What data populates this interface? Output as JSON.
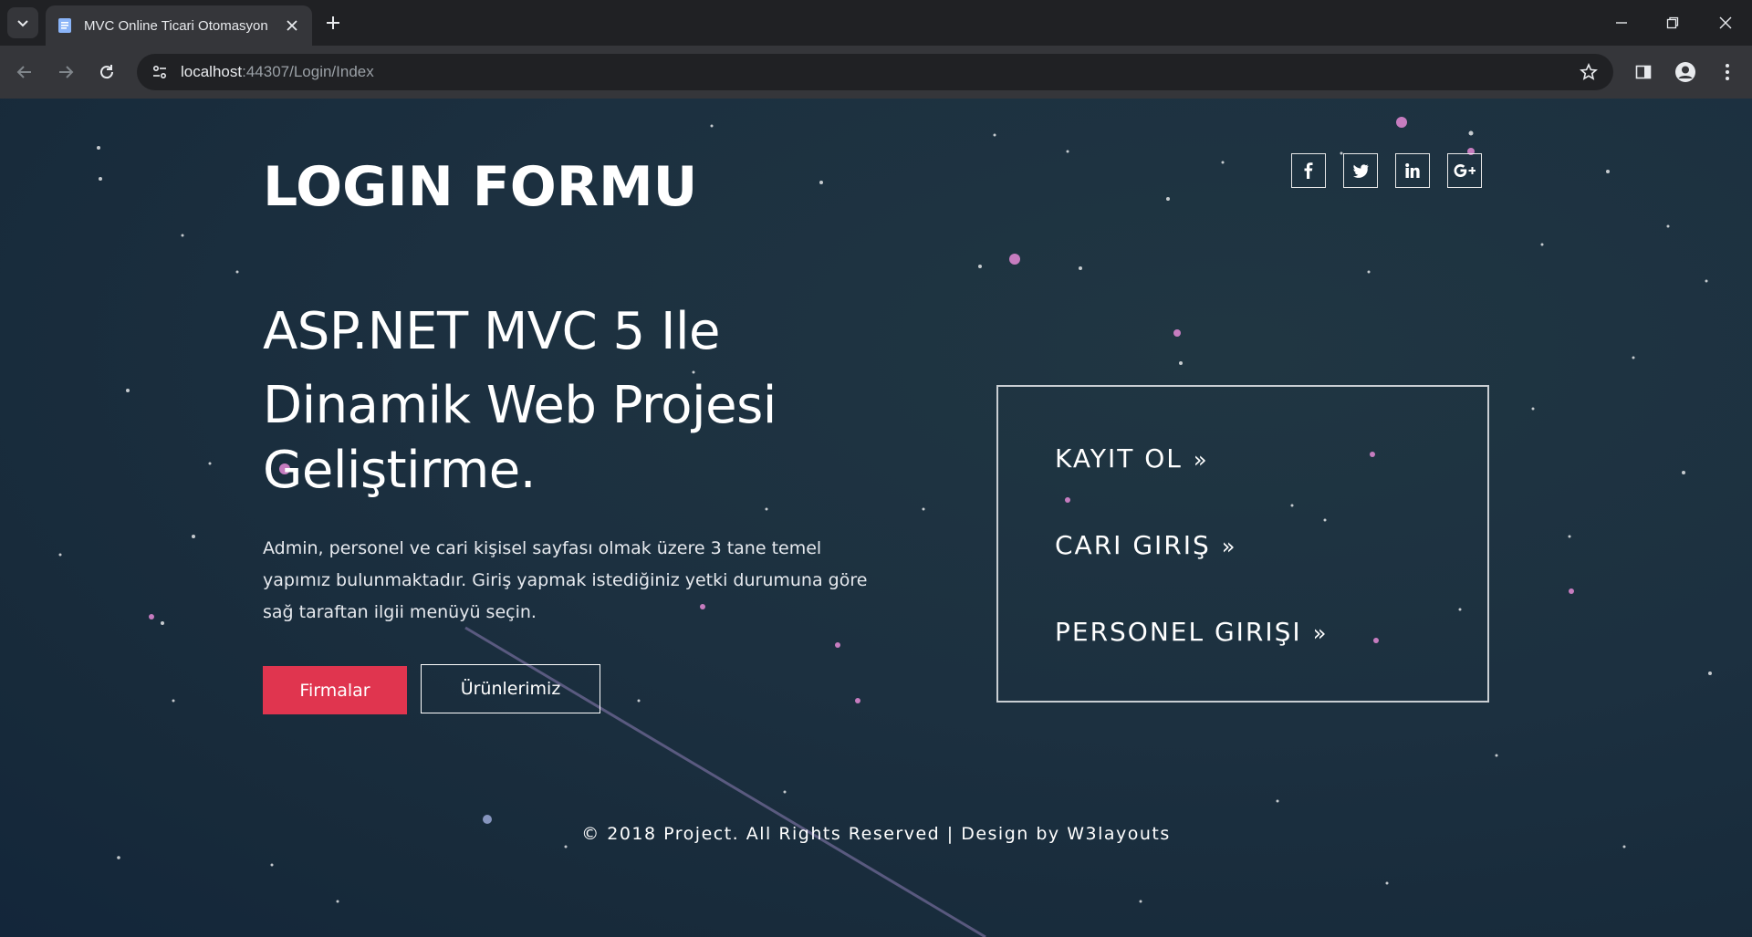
{
  "browser": {
    "tab_title": "MVC Online Ticari Otomasyon",
    "url_host": "localhost",
    "url_rest": ":44307/Login/Index",
    "icons": [
      "tab-search-icon",
      "page-favicon-icon",
      "close-icon",
      "plus-icon",
      "back-arrow-icon",
      "forward-arrow-icon",
      "reload-icon",
      "site-info-icon",
      "star-icon",
      "side-panel-icon",
      "profile-icon",
      "kebab-menu-icon",
      "minimize-icon",
      "restore-icon",
      "window-close-icon"
    ]
  },
  "page": {
    "logo_title": "LOGIN FORMU",
    "social": [
      {
        "name": "facebook",
        "glyph": "f"
      },
      {
        "name": "twitter",
        "glyph": "t"
      },
      {
        "name": "linkedin",
        "glyph": "in"
      },
      {
        "name": "google-plus",
        "glyph": "G+"
      }
    ],
    "hero_line1": "ASP.NET MVC 5 Ile",
    "hero_line2": "Dinamik Web Projesi",
    "hero_line3": "Geliştirme.",
    "description": "Admin, personel ve cari kişisel sayfası olmak üzere 3 tane temel yapımız bulunmaktadır. Giriş yapmak istediğiniz yetki durumuna göre sağ taraftan ilgii menüyü seçin.",
    "btn_firmalar": "Firmalar",
    "btn_urunlerimiz": "Ürünlerimiz",
    "menu": {
      "kayit": "KAYIT OL",
      "cari": "CARI GIRIŞ",
      "personel": "PERSONEL GIRIŞI",
      "arrow": "»"
    },
    "footer": "© 2018 Project. All Rights Reserved | Design by W3layouts"
  },
  "colors": {
    "primary_button": "#e0354f",
    "page_bg": "#1c3040",
    "chrome_bg": "#202124",
    "toolbar_bg": "#35363a"
  }
}
